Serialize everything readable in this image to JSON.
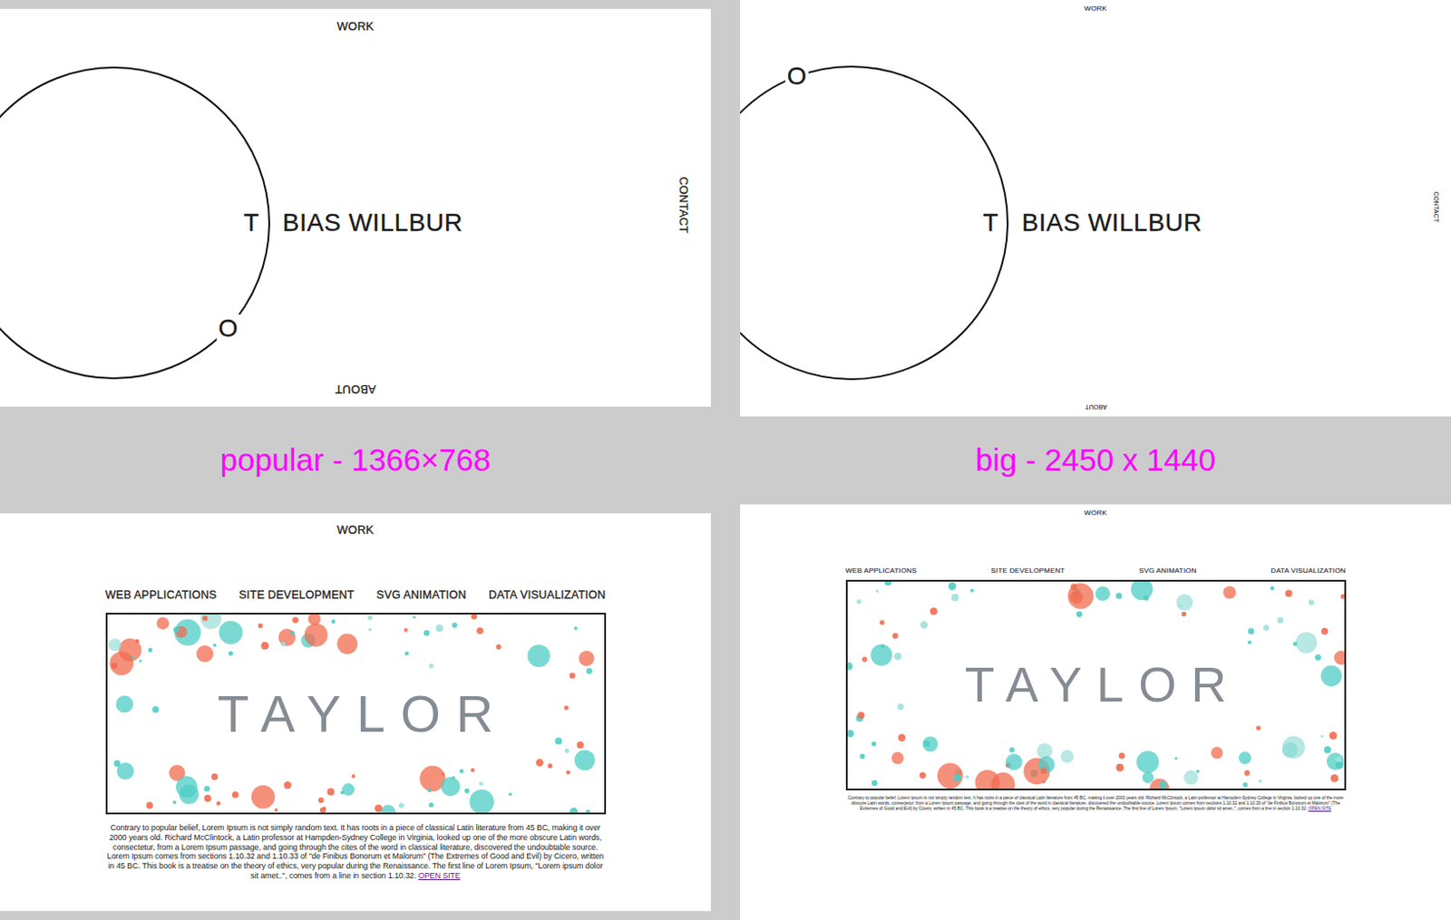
{
  "columns": [
    {
      "label": "popular - 1366×768",
      "home": {
        "nav_top": "WORK",
        "nav_right": "CONTACT",
        "nav_bottom": "ABOUT",
        "logo": {
          "first": "T",
          "orbit": "O",
          "rest": "BIAS WILLBUR"
        }
      },
      "work": {
        "nav_top": "WORK",
        "categories": [
          "WEB APPLICATIONS",
          "SITE DEVELOPMENT",
          "SVG ANIMATION",
          "DATA VISUALIZATION"
        ],
        "project": {
          "title": "TAYLOR",
          "description": "Contrary to popular belief, Lorem Ipsum is not simply random text. It has roots in a piece of classical Latin literature from 45 BC, making it over 2000 years old. Richard McClintock, a Latin professor at Hampden-Sydney College in Virginia, looked up one of the more obscure Latin words, consectetur, from a Lorem Ipsum passage, and going through the cites of the word in classical literature, discovered the undoubtable source. Lorem Ipsum comes from sections 1.10.32 and 1.10.33 of \"de Finibus Bonorum et Malorum\" (The Extremes of Good and Evil) by Cicero, written in 45 BC. This book is a treatise on the theory of ethics, very popular during the Renaissance. The first line of Lorem Ipsum, \"Lorem ipsum dolor sit amet..\", comes from a line in section 1.10.32.",
          "link": "OPEN SITE"
        }
      }
    },
    {
      "label": "big - 2450 x 1440",
      "home": {
        "nav_top": "WORK",
        "nav_right": "CONTACT",
        "nav_bottom": "ABOUT",
        "logo": {
          "first": "T",
          "orbit": "O",
          "rest": "BIAS WILLBUR"
        }
      },
      "work": {
        "nav_top": "WORK",
        "categories": [
          "WEB APPLICATIONS",
          "SITE DEVELOPMENT",
          "SVG ANIMATION",
          "DATA VISUALIZATION"
        ],
        "project": {
          "title": "TAYLOR",
          "description": "Contrary to popular belief, Lorem Ipsum is not simply random text. It has roots in a piece of classical Latin literature from 45 BC, making it over 2000 years old. Richard McClintock, a Latin professor at Hampden-Sydney College in Virginia, looked up one of the more obscure Latin words, consectetur, from a Lorem Ipsum passage, and going through the cites of the word in classical literature, discovered the undoubtable source. Lorem Ipsum comes from sections 1.10.32 and 1.10.33 of \"de Finibus Bonorum et Malorum\" (The Extremes of Good and Evil) by Cicero, written in 45 BC. This book is a treatise on the theory of ethics, very popular during the Renaissance. The first line of Lorem Ipsum, \"Lorem ipsum dolor sit amet..\", comes from a line in section 1.10.32.",
          "link": "OPEN SITE"
        }
      }
    }
  ]
}
